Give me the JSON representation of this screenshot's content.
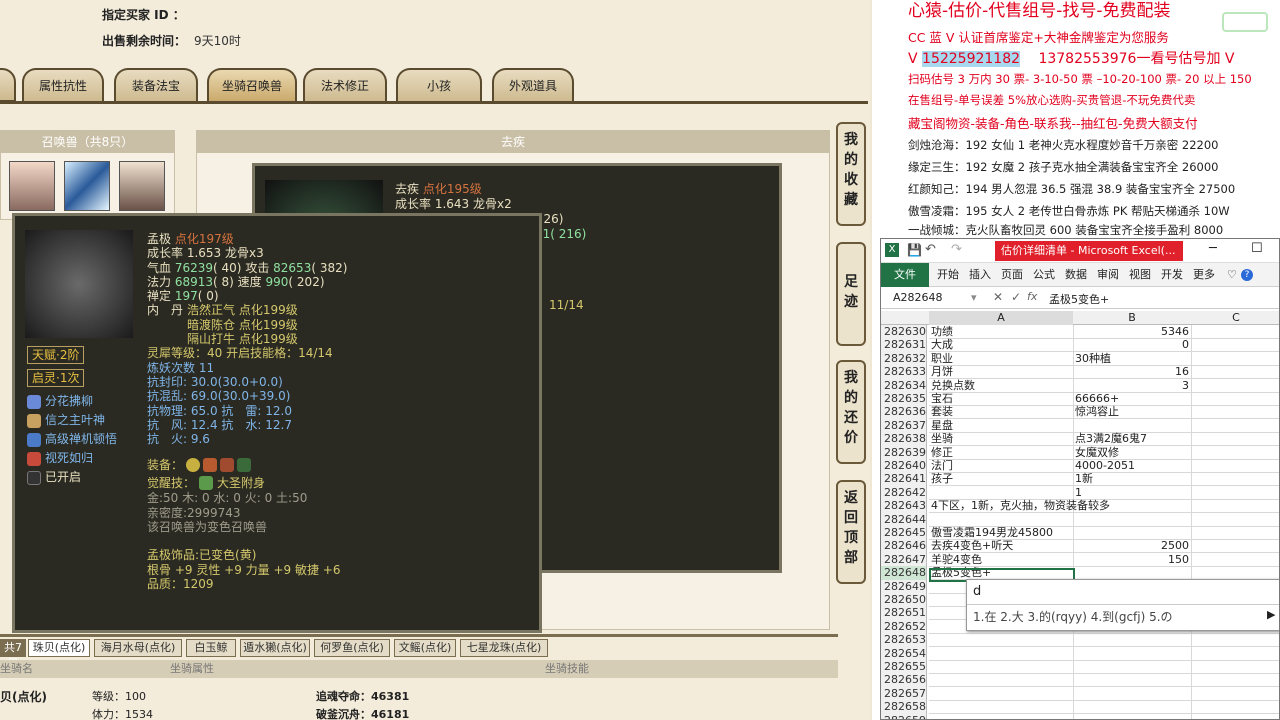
{
  "game": {
    "buyer_label": "指定买家 ID ：",
    "remaining_label": "出售剩余时间：",
    "remaining_value": "9天10时",
    "tabs": [
      "属性抗性",
      "装备法宝",
      "坐骑召唤兽",
      "法术修正",
      "小孩",
      "外观道具"
    ],
    "pet_list_header": "召唤兽（共8只）",
    "detail_header": "去疾",
    "side_buttons": [
      [
        "我",
        "的",
        "收",
        "藏"
      ],
      [
        "足",
        "迹"
      ],
      [
        "我",
        "的",
        "还",
        "价"
      ],
      [
        "返",
        "回",
        "顶",
        "部"
      ]
    ],
    "back_tooltip": {
      "name": "去疾",
      "rank": "点化195级",
      "growth": "成长率 1.643 龙骨x2",
      "partial_a": "( 26)",
      "partial_b": "01( 216)",
      "partial_c": "11/14"
    },
    "tooltip": {
      "name": "孟极",
      "rank": "点化197级",
      "growth": "成长率 1.653 龙骨x3",
      "hp_label": "气血",
      "hp": "76239",
      "hp_pts": "( 40)",
      "atk_label": "攻击",
      "atk": "82653",
      "atk_pts": "( 382)",
      "mp_label": "法力",
      "mp": "68913",
      "mp_pts": "( 8)",
      "spd_label": "速度",
      "spd": "990",
      "spd_pts": "( 202)",
      "def_label": "禅定",
      "def": "197",
      "def_pts": "( 0)",
      "neidan_label": "内　丹",
      "neidan": [
        "浩然正气 点化199级",
        "暗渡陈仓 点化199级",
        "隔山打牛 点化199级"
      ],
      "soul_label": "灵犀等级：",
      "soul": "40 开启技能格：14/14",
      "refine": "炼妖次数 11",
      "res": [
        "抗封印: 30.0(30.0+0.0)",
        "抗混乱: 69.0(30.0+39.0)",
        "抗物理: 65.0 抗　雷: 12.0",
        "抗　风: 12.4 抗　水: 12.7",
        "抗　火: 9.6"
      ],
      "talent": "天赋·2阶",
      "awaken": "启灵·1次",
      "skills": [
        "分花拂柳",
        "信之主叶神",
        "高级禅机顿悟",
        "视死如归",
        "已开启"
      ],
      "equip_label": "装备：",
      "awake_skill_label": "觉醒技：",
      "awake_skill": "大圣附身",
      "elements": "金:50 木: 0 水: 0 火: 0 土:50",
      "intimacy": "亲密度:2999743",
      "variant_note": "该召唤兽为变色召唤兽",
      "ornament": "孟极饰品:已变色(黄)",
      "ornament_stats": "根骨 +9 灵性 +9 力量 +9 敏捷 +6",
      "quality": "品质：1209"
    },
    "mount_tabs": [
      "共7只",
      "珠贝(点化)",
      "海月水母(点化)",
      "白玉鲸",
      "遁水獭(点化)",
      "何罗鱼(点化)",
      "文鳐(点化)",
      "七星龙珠(点化)"
    ],
    "mount_cols": [
      "坐骑名",
      "坐骑属性",
      "坐骑技能"
    ],
    "mount_name": "贝(点化)",
    "mount_level": "等级：100",
    "mount_hp": "体力：1534",
    "mount_sk1": "追魂夺命：46381",
    "mount_sk2": "破釜沉舟：46181"
  },
  "ad": {
    "title": "心猿-估价-代售组号-找号-免费配装",
    "lines": [
      "CC 蓝 V 认证首席鉴定+大神金牌鉴定为您服务",
      "V 15225921182　 13782553976一看号估号加 V",
      "扫码估号 3 万内 30 票- 3-10-50 票 –10-20-100 票- 20 以上 150",
      "在售组号-单号误差 5%放心选购-买贵管退-不玩免费代卖",
      "藏宝阁物资-装备-角色-联系我--抽红包-免费大额支付"
    ],
    "phone_highlight": "15225921182",
    "entries": [
      "剑烛沧海：192 女仙 1 老神火克水程度妙音千万亲密 22200",
      "缘定三生：192 女魔 2 孩子克水抽全满装备宝宝齐全 26000",
      "红颜知己：194 男人忽混 36.5 强混 38.9 装备宝宝齐全 27500",
      "傲雪凌霜：195 女人 2 老传世白骨赤炼 PK 帮贴天梯通杀 10W",
      "一战倾城：克火队畜牧回灵 600 装备宝宝齐全接手盈利 8000"
    ]
  },
  "excel": {
    "title": "估价详细清单 - Microsoft Excel(...",
    "menu": [
      "文件",
      "开始",
      "插入",
      "页面",
      "公式",
      "数据",
      "审阅",
      "视图",
      "开发",
      "更多"
    ],
    "namebox": "A282648",
    "formula": "孟极5变色+",
    "cols": [
      "A",
      "B",
      "C"
    ],
    "rows": [
      [
        "282630",
        "功绩",
        "5346",
        true
      ],
      [
        "282631",
        "大成",
        "0",
        true
      ],
      [
        "282632",
        "职业",
        "30种植",
        false
      ],
      [
        "282633",
        "月饼",
        "16",
        true
      ],
      [
        "282634",
        "兑换点数",
        "3",
        true
      ],
      [
        "282635",
        "宝石",
        "66666+",
        false
      ],
      [
        "282636",
        "套装",
        "惊鸿容止",
        false
      ],
      [
        "282637",
        "星盘",
        "",
        false
      ],
      [
        "282638",
        "坐骑",
        "点3满2魔6鬼7",
        false
      ],
      [
        "282639",
        "修正",
        "女魔双修",
        false
      ],
      [
        "282640",
        "法门",
        "4000-2051",
        false
      ],
      [
        "282641",
        "孩子",
        "1新",
        false
      ],
      [
        "282642",
        "",
        "1",
        false
      ],
      [
        "282643",
        "4下区，1新，克火抽，物资装备较多",
        "",
        false
      ],
      [
        "282644",
        "",
        "",
        false
      ],
      [
        "282645",
        "傲雪凌霜194男龙45800",
        "",
        false
      ],
      [
        "282646",
        "去疾4变色+听天",
        "2500",
        true
      ],
      [
        "282647",
        "羊驼4变色",
        "150",
        true
      ],
      [
        "282648",
        "孟极5变色+",
        "",
        false
      ],
      [
        "282649",
        "",
        "",
        false
      ],
      [
        "282650",
        "",
        "",
        false
      ],
      [
        "282651",
        "",
        "",
        false
      ],
      [
        "282652",
        "",
        "",
        false
      ],
      [
        "282653",
        "",
        "",
        false
      ],
      [
        "282654",
        "",
        "",
        false
      ],
      [
        "282655",
        "",
        "",
        false
      ],
      [
        "282656",
        "",
        "",
        false
      ],
      [
        "282657",
        "",
        "",
        false
      ],
      [
        "282658",
        "",
        "",
        false
      ],
      [
        "282659",
        "",
        "",
        false
      ]
    ],
    "ime_input": "d",
    "ime_candidates": "1.在  2.大  3.的(rqyy)  4.到(gcfj)  5.の"
  },
  "colors": {
    "accent_red": "#e1001e",
    "excel_green": "#217346",
    "tooltip_bg": "#2b2a22"
  }
}
